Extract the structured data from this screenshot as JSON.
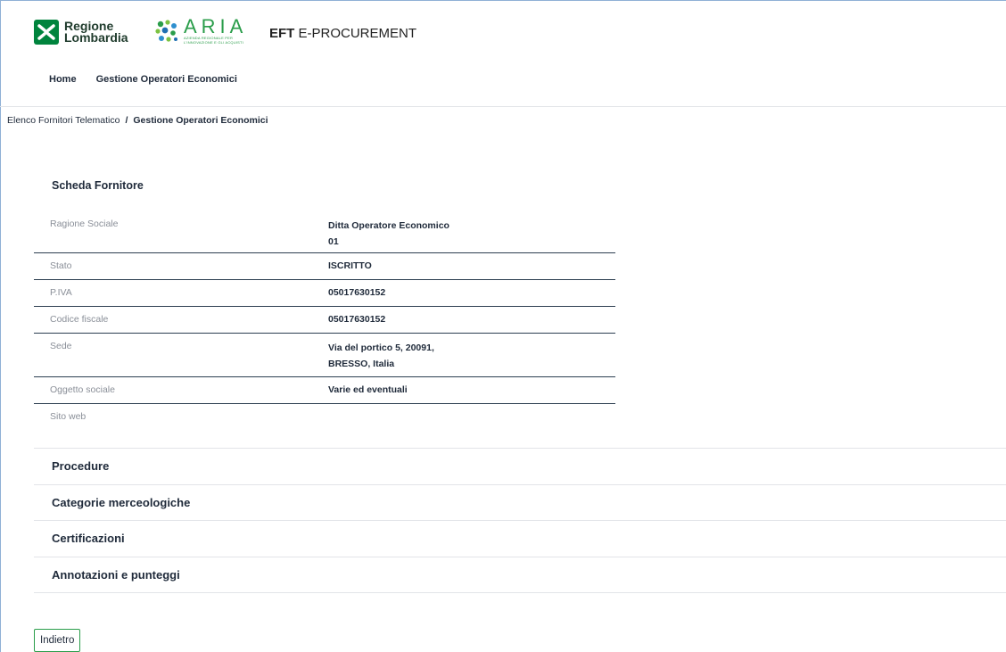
{
  "header": {
    "region_logo_line1": "Regione",
    "region_logo_line2": "Lombardia",
    "aria_logo_text": "ARIA",
    "aria_logo_subtitle_line1": "AZIENDA REGIONALE PER",
    "aria_logo_subtitle_line2": "L'INNOVAZIONE E GLI ACQUISTI",
    "app_title_bold": "EFT",
    "app_title_rest": " E-PROCUREMENT",
    "brand_green": "#00843d",
    "aria_green": "#2a9d4a"
  },
  "nav": {
    "items": [
      "Home",
      "Gestione Operatori Economici"
    ]
  },
  "breadcrumb": {
    "items": [
      "Elenco Fornitori Telematico",
      "Gestione Operatori Economici"
    ],
    "separator": "/"
  },
  "scheda": {
    "title": "Scheda Fornitore",
    "rows": [
      {
        "label": "Ragione Sociale",
        "value_line1": "Ditta Operatore Economico",
        "value_line2": "01"
      },
      {
        "label": "Stato",
        "value_line1": "ISCRITTO",
        "value_line2": ""
      },
      {
        "label": "P.IVA",
        "value_line1": "05017630152",
        "value_line2": ""
      },
      {
        "label": "Codice fiscale",
        "value_line1": "05017630152",
        "value_line2": ""
      },
      {
        "label": "Sede",
        "value_line1": "Via del portico 5, 20091,",
        "value_line2": "BRESSO, Italia"
      },
      {
        "label": "Oggetto sociale",
        "value_line1": "Varie ed eventuali",
        "value_line2": ""
      },
      {
        "label": "Sito web",
        "value_line1": "",
        "value_line2": ""
      }
    ]
  },
  "sections": [
    "Procedure",
    "Categorie merceologiche",
    "Certificazioni",
    "Annotazioni e punteggi"
  ],
  "actions": {
    "back_label": "Indietro"
  }
}
